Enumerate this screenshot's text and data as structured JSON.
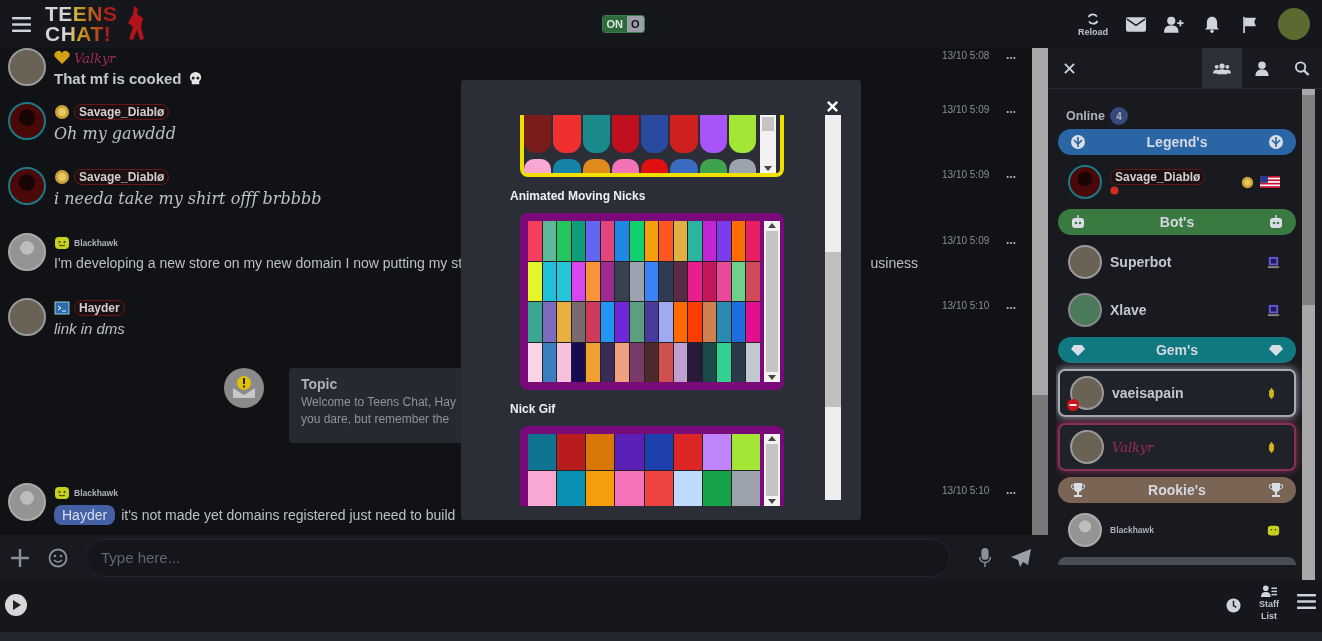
{
  "header": {
    "logo": [
      "TEENS",
      "CHAT!"
    ],
    "toggle": {
      "on": true,
      "on_label": "ON",
      "off_label": "O"
    },
    "reload_label": "Reload"
  },
  "messages": [
    {
      "name": "Valkyr",
      "text": "That mf is cooked",
      "time": "13/10 5:08"
    },
    {
      "name": "Savage_Diablø",
      "text": "Oh my gawddd",
      "time": "13/10 5:09"
    },
    {
      "name": "Savage_Diablø",
      "text": "i needa take my shirt offf brbbbb",
      "time": "13/10 5:09"
    },
    {
      "name": "Blackhawk",
      "text": "I'm developing a new store on my new domain I now putting my st",
      "text_right": "usiness",
      "time": "13/10 5:09"
    },
    {
      "name": "Hayder",
      "text": "link in dms",
      "time": "13/10 5:10"
    }
  ],
  "topic": {
    "title": "Topic",
    "lines": [
      "Welcome to Teens Chat, Hay",
      "you dare, but remember the"
    ]
  },
  "last_message": {
    "name": "Blackhawk",
    "mention": "Hayder",
    "text": "it's not made yet domains registered just need to build",
    "time": "13/10 5:10"
  },
  "input": {
    "placeholder": "Type here..."
  },
  "modal": {
    "top_rows": [
      [
        {
          "color": "#7a1c1c"
        },
        {
          "color": "#f03030"
        },
        {
          "color": "#1a8a8a"
        },
        {
          "color": "#c01020"
        },
        {
          "color": "#2a4aa0"
        },
        {
          "color": "#d02020"
        },
        {
          "color": "#a855f7"
        },
        {
          "color": "#a3e635"
        }
      ],
      [
        {
          "color": "#f9a8d4"
        },
        {
          "color": "#1583a8"
        },
        {
          "color": "#e08a1a"
        },
        {
          "color": "#f472b6"
        },
        {
          "color": "#e01010"
        },
        {
          "color": "#3b6bc0"
        },
        {
          "color": "#3fa34d"
        },
        {
          "color": "#9ca3af"
        }
      ]
    ],
    "sections": [
      {
        "title": "Animated Moving Nicks",
        "rows": [
          [
            {
              "color": "#f43f5e"
            },
            {
              "color": "#5fb89a"
            },
            {
              "color": "#22c55e"
            },
            {
              "color": "#0f9d7a"
            },
            {
              "color": "#6366f1"
            },
            {
              "color": "#e0457b"
            },
            {
              "color": "#1e88e5"
            },
            {
              "color": "#10d070"
            },
            {
              "color": "#f59e0b"
            },
            {
              "color": "#ff5722"
            },
            {
              "color": "#e0b040"
            },
            {
              "color": "#2bb5a0"
            },
            {
              "color": "#c026d3"
            },
            {
              "color": "#7c3aed"
            },
            {
              "color": "#ff6d00"
            },
            {
              "color": "#e91e63"
            }
          ],
          [
            {
              "color": "#e5f52a"
            },
            {
              "color": "#22c0d8"
            },
            {
              "color": "#26c6da"
            },
            {
              "color": "#d946ef"
            },
            {
              "color": "#fb923c"
            },
            {
              "color": "#9d2a8f"
            },
            {
              "color": "#374151"
            },
            {
              "color": "#9ca3af"
            },
            {
              "color": "#3b82f6"
            },
            {
              "color": "#2f3b55"
            },
            {
              "color": "#5a2a45"
            },
            {
              "color": "#e91e8c"
            },
            {
              "color": "#c2185b"
            },
            {
              "color": "#ec4899"
            },
            {
              "color": "#6ed08a"
            },
            {
              "color": "#d04a5a"
            }
          ],
          [
            {
              "color": "#3aa890"
            },
            {
              "color": "#7c6cc0"
            },
            {
              "color": "#e8b040"
            },
            {
              "color": "#7a6a70"
            },
            {
              "color": "#d03a5a"
            },
            {
              "color": "#2196f3"
            },
            {
              "color": "#6d28d9"
            },
            {
              "color": "#5aa080"
            },
            {
              "color": "#4a3a9a"
            },
            {
              "color": "#a0aaf0"
            },
            {
              "color": "#ff6a00"
            },
            {
              "color": "#ff3d00"
            },
            {
              "color": "#d08050"
            },
            {
              "color": "#2a8ab0"
            },
            {
              "color": "#1e6ee0"
            },
            {
              "color": "#e01090"
            }
          ],
          [
            {
              "color": "#fbd5e5"
            },
            {
              "color": "#3a80c0"
            },
            {
              "color": "#f8c0e0"
            },
            {
              "color": "#1a0a50"
            },
            {
              "color": "#f0a030"
            },
            {
              "color": "#3a2a5a"
            },
            {
              "color": "#f0a080"
            },
            {
              "color": "#7a3a6a"
            },
            {
              "color": "#4a2a2a"
            },
            {
              "color": "#d05050"
            },
            {
              "color": "#c0a0d0"
            },
            {
              "color": "#2a1a3a"
            },
            {
              "color": "#1a4a4a"
            },
            {
              "color": "#30d090"
            },
            {
              "color": "#2a3a4a"
            },
            {
              "color": "#c0c8d0"
            }
          ]
        ]
      },
      {
        "title": "Nick Gif",
        "rows": [
          [
            {
              "color": "#0e7490"
            },
            {
              "color": "#b91c1c"
            },
            {
              "color": "#d97706"
            },
            {
              "color": "#5b21b6"
            },
            {
              "color": "#1e40af"
            },
            {
              "color": "#dc2626"
            },
            {
              "color": "#c084fc"
            },
            {
              "color": "#a3e635"
            }
          ],
          [
            {
              "color": "#f9a8d4"
            },
            {
              "color": "#0891b2"
            },
            {
              "color": "#f59e0b"
            },
            {
              "color": "#f472b6"
            },
            {
              "color": "#ef4444"
            },
            {
              "color": "#bfdbfe"
            },
            {
              "color": "#16a34a"
            },
            {
              "color": "#9ca3af"
            }
          ]
        ]
      }
    ]
  },
  "sidebar": {
    "tabs": [
      {
        "kind": "group",
        "selected": true
      },
      {
        "kind": "user",
        "selected": false
      },
      {
        "kind": "search",
        "selected": false
      }
    ],
    "online": {
      "label": "Online",
      "count": "4"
    },
    "entries": [
      {
        "kind": "group",
        "label": "Legend's",
        "color": "#2a66a6"
      },
      {
        "kind": "user",
        "name": "Savage_Diablø",
        "sub_badge": true
      },
      {
        "kind": "group",
        "label": "Bot's",
        "color": "#3a7a40"
      },
      {
        "kind": "user",
        "name": "Superbot"
      },
      {
        "kind": "user",
        "name": "Xlave"
      },
      {
        "kind": "group",
        "label": "Gem's",
        "color": "#107880"
      },
      {
        "kind": "user",
        "name": "vaeisapain",
        "busy": true,
        "color": "#a8acb4"
      },
      {
        "kind": "user",
        "name": "Valkyr",
        "color": "#8a3055"
      },
      {
        "kind": "group",
        "label": "Rookie's",
        "color": "#7a6555"
      },
      {
        "kind": "user",
        "name": "Blackhawk"
      },
      {
        "kind": "group",
        "color": "#484c54"
      }
    ]
  },
  "footer": {
    "staff_label": "Staff List"
  }
}
